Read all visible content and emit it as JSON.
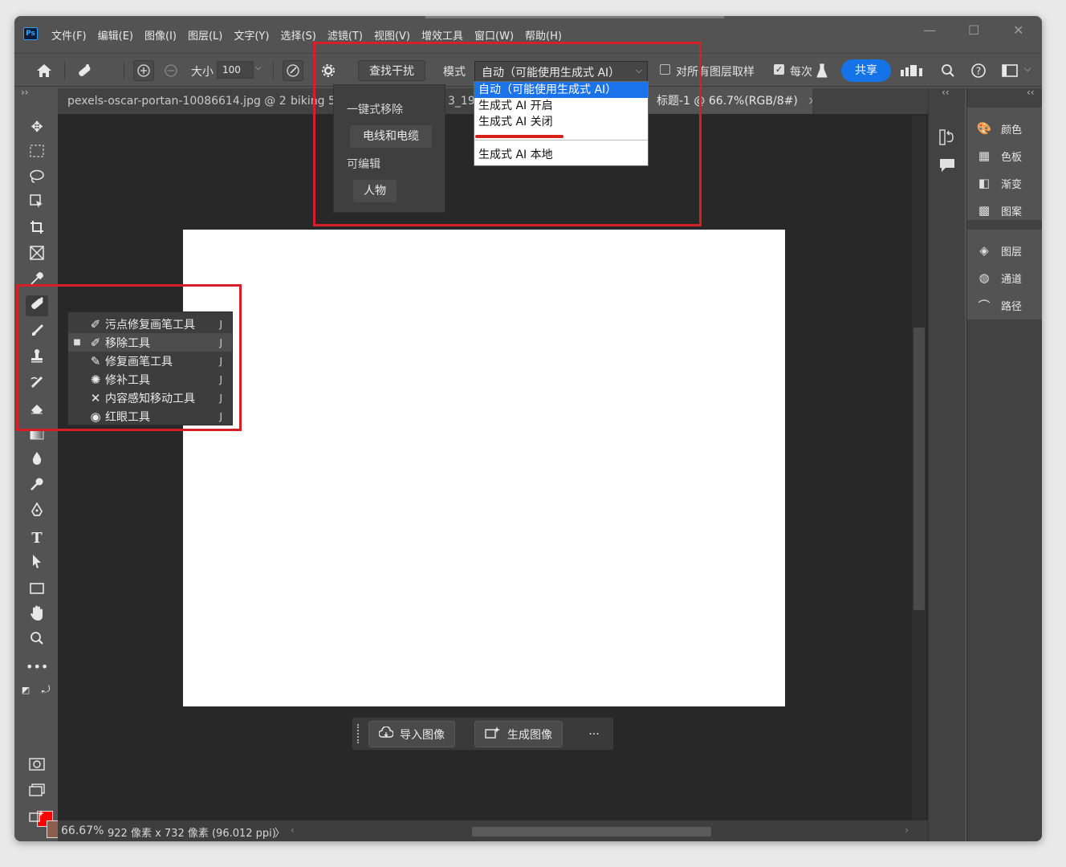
{
  "app": {
    "logo_text": "Ps"
  },
  "menu": [
    "文件(F)",
    "编辑(E)",
    "图像(I)",
    "图层(L)",
    "文字(Y)",
    "选择(S)",
    "滤镜(T)",
    "视图(V)",
    "增效工具",
    "窗口(W)",
    "帮助(H)"
  ],
  "window_controls": {
    "minimize": "—",
    "maximize": "☐",
    "close": "✕"
  },
  "options": {
    "size_label": "大小",
    "size_value": "100",
    "find_interference_label": "查找干扰",
    "mode_label": "模式",
    "mode_value": "自动（可能使用生成式 AI）",
    "sample_all_layers_label": "对所有图层取样",
    "sample_all_layers_checked": false,
    "every_stroke_label": "每次",
    "share_label": "共享"
  },
  "mode_dropdown": {
    "options": [
      "自动（可能使用生成式 AI）",
      "生成式 AI 开启",
      "生成式 AI 关闭",
      "生成式 AI 本地"
    ],
    "selected": 0
  },
  "interference_panel": {
    "one_click_label": "一键式移除",
    "wires_button": "电线和电缆",
    "editable_label": "可编辑",
    "people_button": "人物"
  },
  "tabs": [
    {
      "label": "pexels-oscar-portan-10086614.jpg @ 25…"
    },
    {
      "label": "biking 568"
    },
    {
      "label": "3_192"
    },
    {
      "label": "标题-1 @ 66.7%(RGB/8#)",
      "active": true
    }
  ],
  "tab_close": "×",
  "tool_flyout": {
    "items": [
      {
        "label": "污点修复画笔工具",
        "key": "J",
        "icon": "spot-healing-icon"
      },
      {
        "label": "移除工具",
        "key": "J",
        "icon": "remove-tool-icon",
        "selected": true
      },
      {
        "label": "修复画笔工具",
        "key": "J",
        "icon": "healing-brush-icon"
      },
      {
        "label": "修补工具",
        "key": "J",
        "icon": "patch-icon"
      },
      {
        "label": "内容感知移动工具",
        "key": "J",
        "icon": "content-aware-move-icon"
      },
      {
        "label": "红眼工具",
        "key": "J",
        "icon": "red-eye-icon"
      }
    ]
  },
  "contextual_taskbar": {
    "import_label": "导入图像",
    "generate_label": "生成图像",
    "more_label": "···"
  },
  "status": {
    "zoom": "66.67%",
    "dimensions": "922 像素 x 732 像素 (96.012 ppi)",
    "arrow": "〉"
  },
  "right_panels": {
    "group1": [
      "颜色",
      "色板",
      "渐变",
      "图案"
    ],
    "group2": [
      "图层",
      "通道",
      "路径"
    ]
  },
  "colors": {
    "foreground": "#ff0000",
    "background": "#8b5e4d",
    "accent": "#1473e6",
    "highlight": "#d5202a"
  }
}
